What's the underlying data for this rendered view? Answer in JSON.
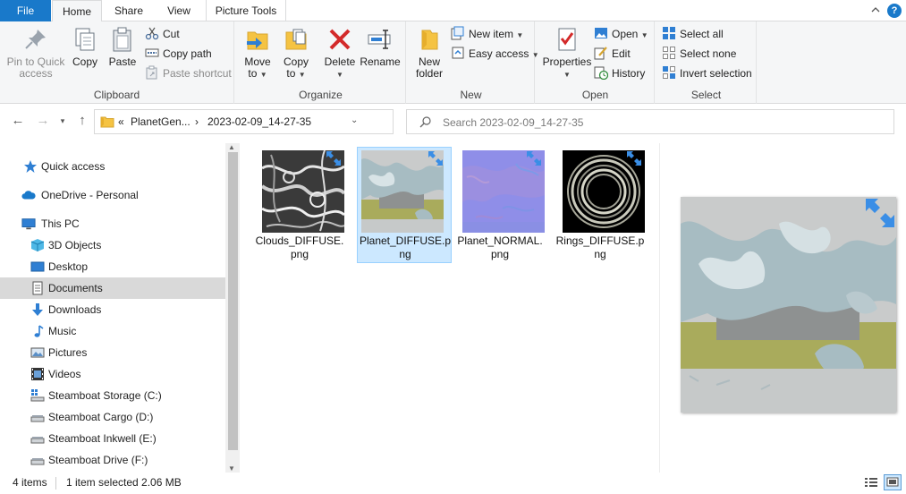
{
  "tabs": {
    "file": "File",
    "home": "Home",
    "share": "Share",
    "view": "View",
    "picture_tools": "Picture Tools"
  },
  "ribbon": {
    "clipboard": {
      "label": "Clipboard",
      "pin_line1": "Pin to Quick",
      "pin_line2": "access",
      "copy": "Copy",
      "paste": "Paste",
      "cut": "Cut",
      "copy_path": "Copy path",
      "paste_shortcut": "Paste shortcut"
    },
    "organize": {
      "label": "Organize",
      "move_to_line1": "Move",
      "move_to_line2": "to",
      "copy_to_line1": "Copy",
      "copy_to_line2": "to",
      "delete": "Delete",
      "rename": "Rename"
    },
    "new": {
      "label": "New",
      "new_folder_line1": "New",
      "new_folder_line2": "folder",
      "new_item": "New item",
      "easy_access": "Easy access"
    },
    "open": {
      "label": "Open",
      "properties": "Properties",
      "open": "Open",
      "edit": "Edit",
      "history": "History"
    },
    "select": {
      "label": "Select",
      "select_all": "Select all",
      "select_none": "Select none",
      "invert_selection": "Invert selection"
    }
  },
  "address": {
    "overflow": "«",
    "segment1": "PlanetGen...",
    "separator": "›",
    "segment2": "2023-02-09_14-27-35"
  },
  "search": {
    "placeholder": "Search 2023-02-09_14-27-35"
  },
  "sidebar": {
    "items": [
      {
        "label": "Quick access"
      },
      {
        "label": "OneDrive - Personal"
      },
      {
        "label": "This PC"
      },
      {
        "label": "3D Objects"
      },
      {
        "label": "Desktop"
      },
      {
        "label": "Documents"
      },
      {
        "label": "Downloads"
      },
      {
        "label": "Music"
      },
      {
        "label": "Pictures"
      },
      {
        "label": "Videos"
      },
      {
        "label": "Steamboat Storage (C:)"
      },
      {
        "label": "Steamboat Cargo (D:)"
      },
      {
        "label": "Steamboat Inkwell (E:)"
      },
      {
        "label": "Steamboat Drive (F:)"
      }
    ],
    "selected": "Documents"
  },
  "files": [
    {
      "name": "Clouds_DIFFUSE.png",
      "line1": "Clouds_DIFFUSE.",
      "line2": "png",
      "selected": false
    },
    {
      "name": "Planet_DIFFUSE.png",
      "line1": "Planet_DIFFUSE.p",
      "line2": "ng",
      "selected": true
    },
    {
      "name": "Planet_NORMAL.png",
      "line1": "Planet_NORMAL.",
      "line2": "png",
      "selected": false
    },
    {
      "name": "Rings_DIFFUSE.png",
      "line1": "Rings_DIFFUSE.p",
      "line2": "ng",
      "selected": false
    }
  ],
  "status": {
    "item_count": "4 items",
    "selection": "1 item selected  2.06 MB"
  },
  "colors": {
    "accent": "#1979ca",
    "selection_bg": "#cce8ff",
    "selection_border": "#99d1ff",
    "sync_badge": "#3a8ee6"
  }
}
